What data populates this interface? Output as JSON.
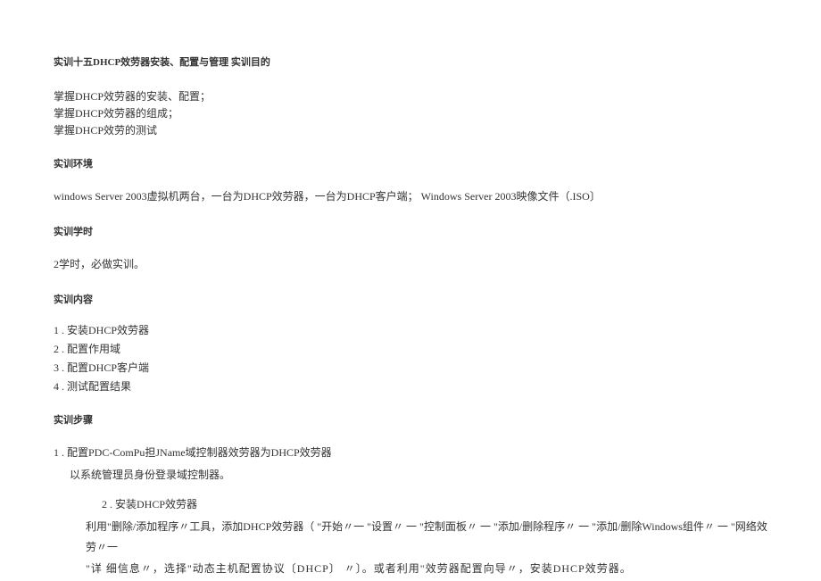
{
  "title": "实训十五DHCP效劳器安装、配置与管理 实训目的",
  "objectives": [
    "掌握DHCP效劳器的安装、配置；",
    "掌握DHCP效劳器的组成；",
    "掌握DHCP效劳的测试"
  ],
  "env_head": "实训环境",
  "env_text": "windows Server 2003虚拟机两台，一台为DHCP效劳器，一台为DHCP客户端；  Windows Server 2003映像文件（.ISO〕",
  "hours_head": "实训学时",
  "hours_text": "2学时，必做实训。",
  "content_head": "实训内容",
  "content_items": [
    "1 . 安装DHCP效劳器",
    "2 . 配置作用域",
    "3 . 配置DHCP客户端",
    "4 . 测试配置结果"
  ],
  "steps_head": "实训步骤",
  "step1_line1": "1 . 配置PDC-ComPu担JName域控制器效劳器为DHCP效劳器",
  "step1_line2": "以系统管理员身份登录域控制器。",
  "step2_head": "2 . 安装DHCP效劳器",
  "step2_line1": "利用\"删除/添加程序〃工具，添加DHCP效劳器（ \"开始〃一 \"设置〃 一 \"控制面板〃 一 \"添加/删除程序〃 一 \"添加/删除Windows组件〃 一 \"网络效劳〃一",
  "step2_line2": "\"详    细信息〃，选择\"动态主机配置协议〔DHCP〕  〃〕。或者利用\"效劳器配置向导〃，安装DHCP效劳器。"
}
